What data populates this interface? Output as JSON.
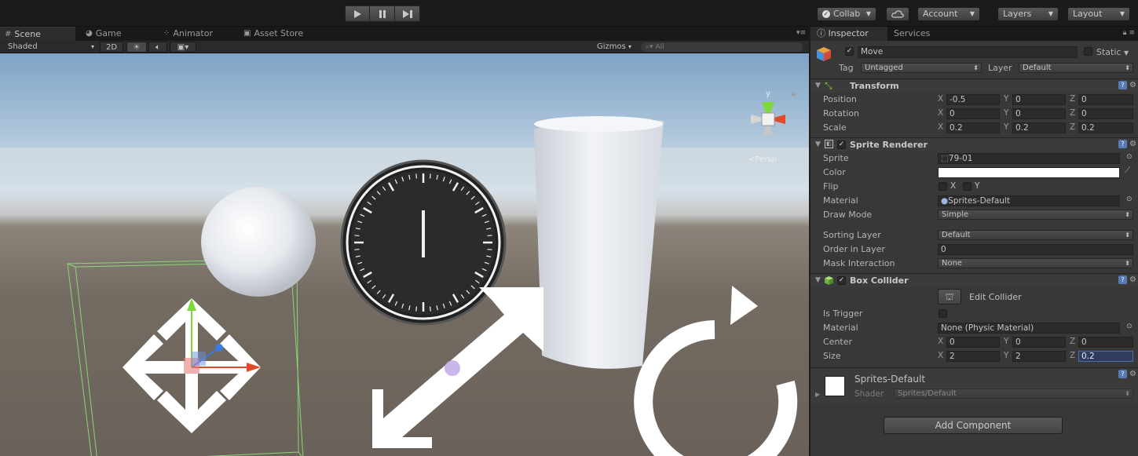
{
  "toolbar": {
    "collab": "Collab",
    "account": "Account",
    "layers": "Layers",
    "layout": "Layout"
  },
  "scene_tabs": [
    "Scene",
    "Game",
    "Animator",
    "Asset Store"
  ],
  "scene_toolbar": {
    "shading": "Shaded",
    "mode_2d": "2D",
    "gizmos": "Gizmos",
    "search_placeholder": "All"
  },
  "gizmo": {
    "persp": "Persp",
    "axis_y": "y"
  },
  "inspector": {
    "tab_inspector": "Inspector",
    "tab_services": "Services",
    "object_name": "Move",
    "static_label": "Static",
    "tag_label": "Tag",
    "tag_value": "Untagged",
    "layer_label": "Layer",
    "layer_value": "Default",
    "transform": {
      "title": "Transform",
      "rows": [
        {
          "label": "Position",
          "x": "-0.5",
          "y": "0",
          "z": "0"
        },
        {
          "label": "Rotation",
          "x": "0",
          "y": "0",
          "z": "0"
        },
        {
          "label": "Scale",
          "x": "0.2",
          "y": "0.2",
          "z": "0.2"
        }
      ]
    },
    "sprite_renderer": {
      "title": "Sprite Renderer",
      "sprite_label": "Sprite",
      "sprite_value": "79-01",
      "color_label": "Color",
      "flip_label": "Flip",
      "flip_x": "X",
      "flip_y": "Y",
      "material_label": "Material",
      "material_value": "Sprites-Default",
      "draw_mode_label": "Draw Mode",
      "draw_mode_value": "Simple",
      "sorting_layer_label": "Sorting Layer",
      "sorting_layer_value": "Default",
      "order_label": "Order in Layer",
      "order_value": "0",
      "mask_label": "Mask Interaction",
      "mask_value": "None"
    },
    "box_collider": {
      "title": "Box Collider",
      "edit_collider": "Edit Collider",
      "is_trigger_label": "Is Trigger",
      "material_label": "Material",
      "material_value": "None (Physic Material)",
      "center_label": "Center",
      "center": {
        "x": "0",
        "y": "0",
        "z": "0"
      },
      "size_label": "Size",
      "size": {
        "x": "2",
        "y": "2",
        "z": "0.2"
      }
    },
    "material_asset": {
      "name": "Sprites-Default",
      "shader_label": "Shader",
      "shader_value": "Sprites/Default"
    },
    "axis_labels": {
      "x": "X",
      "y": "Y",
      "z": "Z"
    },
    "add_component": "Add Component"
  },
  "colors": {
    "sky_top": "#7fa3c6",
    "ground": "#746b62",
    "panel": "#383838",
    "accent_blue": "#3c5f9b"
  }
}
